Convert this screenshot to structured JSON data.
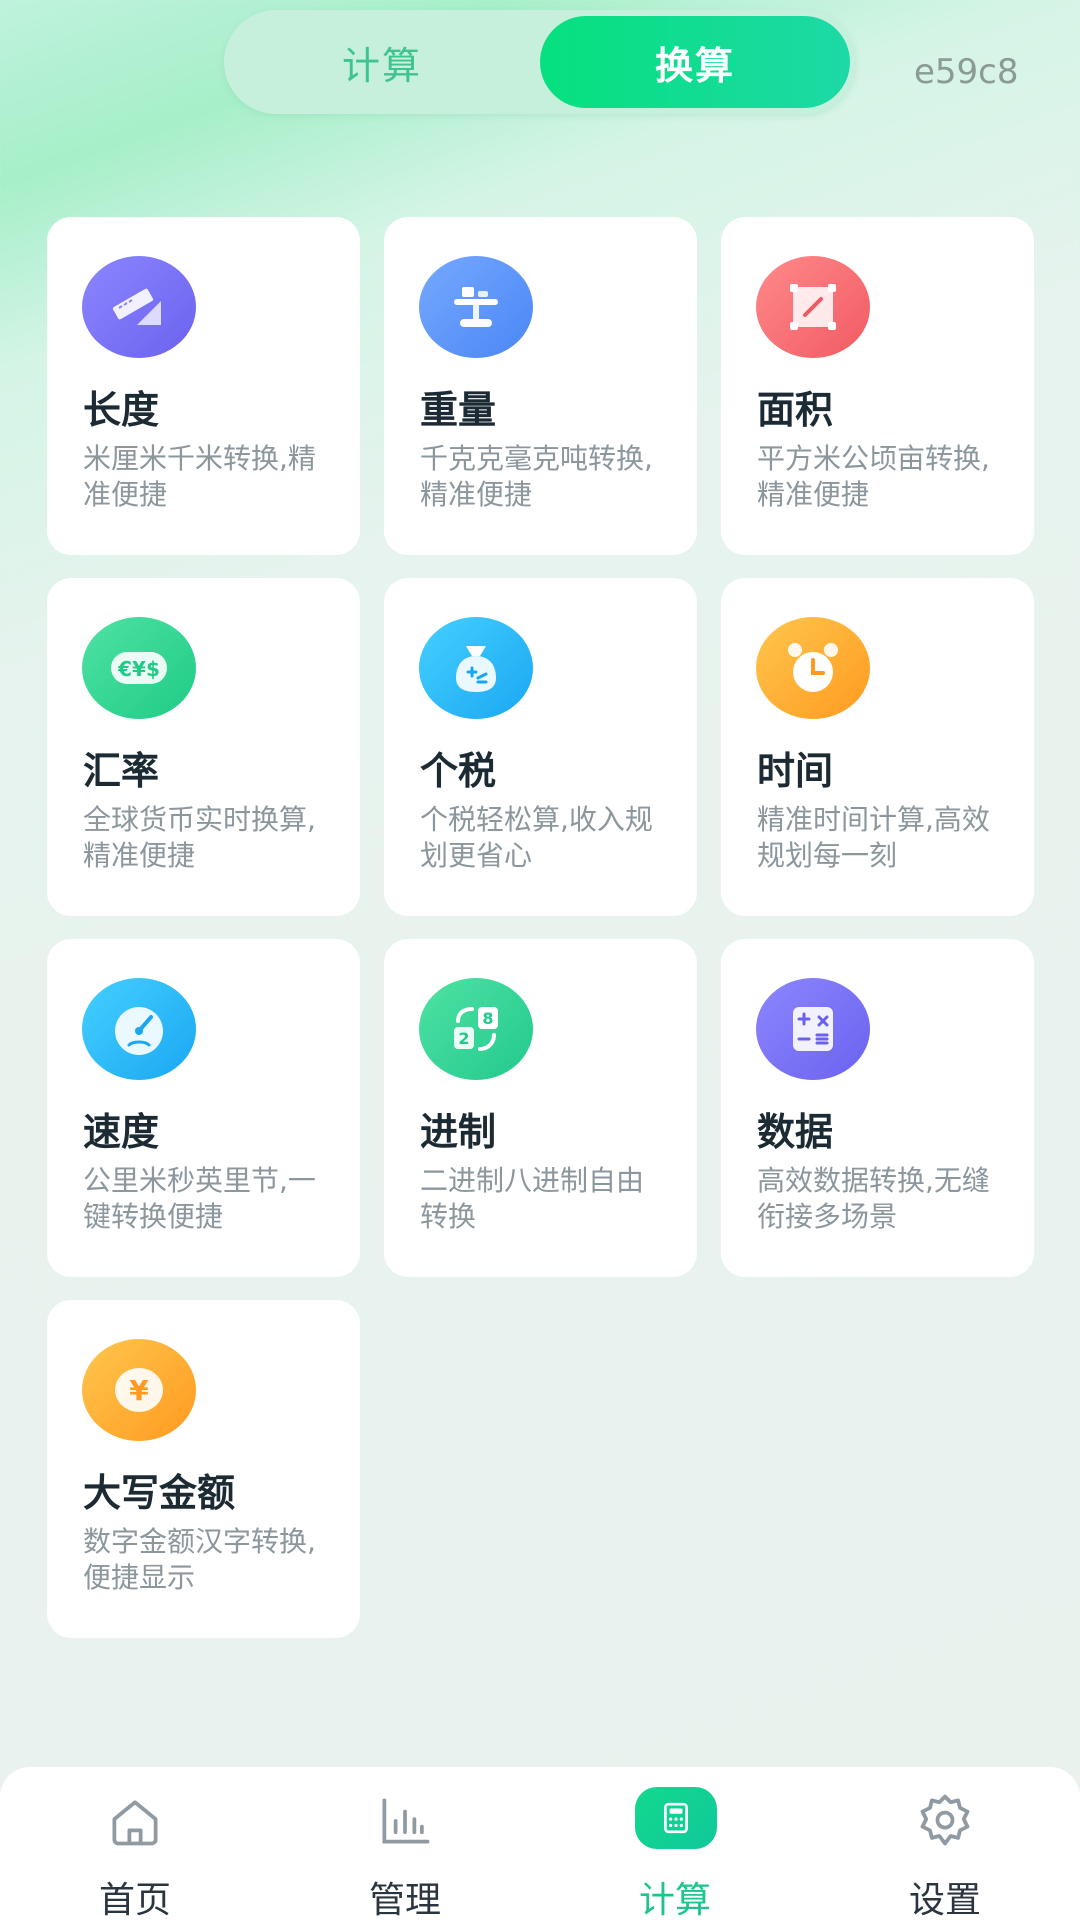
{
  "header": {
    "tabs": [
      {
        "label": "计算",
        "active": false
      },
      {
        "label": "换算",
        "active": true
      }
    ],
    "code": "e59c8"
  },
  "cards": [
    {
      "title": "长度",
      "desc": "米厘米千米转换,精准便捷",
      "icon": "ruler-icon",
      "color": "#7a72f7"
    },
    {
      "title": "重量",
      "desc": "千克克毫克吨转换,精准便捷",
      "icon": "scale-icon",
      "color": "#5d94f8"
    },
    {
      "title": "面积",
      "desc": "平方米公顷亩转换,精准便捷",
      "icon": "area-icon",
      "color": "#f56b73"
    },
    {
      "title": "汇率",
      "desc": "全球货币实时换算,精准便捷",
      "icon": "currency-icon",
      "color": "#2fd391"
    },
    {
      "title": "个税",
      "desc": "个税轻松算,收入规划更省心",
      "icon": "money-bag-icon",
      "color": "#2bb8f6"
    },
    {
      "title": "时间",
      "desc": "精准时间计算,高效规划每一刻",
      "icon": "alarm-clock-icon",
      "color": "#ffab33"
    },
    {
      "title": "速度",
      "desc": "公里米秒英里节,一键转换便捷",
      "icon": "speedometer-icon",
      "color": "#2bb8f6"
    },
    {
      "title": "进制",
      "desc": "二进制八进制自由转换",
      "icon": "base-convert-icon",
      "color": "#2fd391"
    },
    {
      "title": "数据",
      "desc": "高效数据转换,无缝衔接多场景",
      "icon": "calculator-icon",
      "color": "#7a72f7"
    },
    {
      "title": "大写金额",
      "desc": "数字金额汉字转换,便捷显示",
      "icon": "yen-coin-icon",
      "color": "#ffab33"
    }
  ],
  "nav": {
    "items": [
      {
        "label": "首页",
        "icon": "home-icon",
        "active": false
      },
      {
        "label": "管理",
        "icon": "bar-chart-icon",
        "active": false
      },
      {
        "label": "计算",
        "icon": "calculator-icon",
        "active": true
      },
      {
        "label": "设置",
        "icon": "gear-icon",
        "active": false
      }
    ]
  },
  "colors": {
    "accent": "#1ec48b",
    "title": "#1c2a33",
    "desc": "#8b969d"
  }
}
